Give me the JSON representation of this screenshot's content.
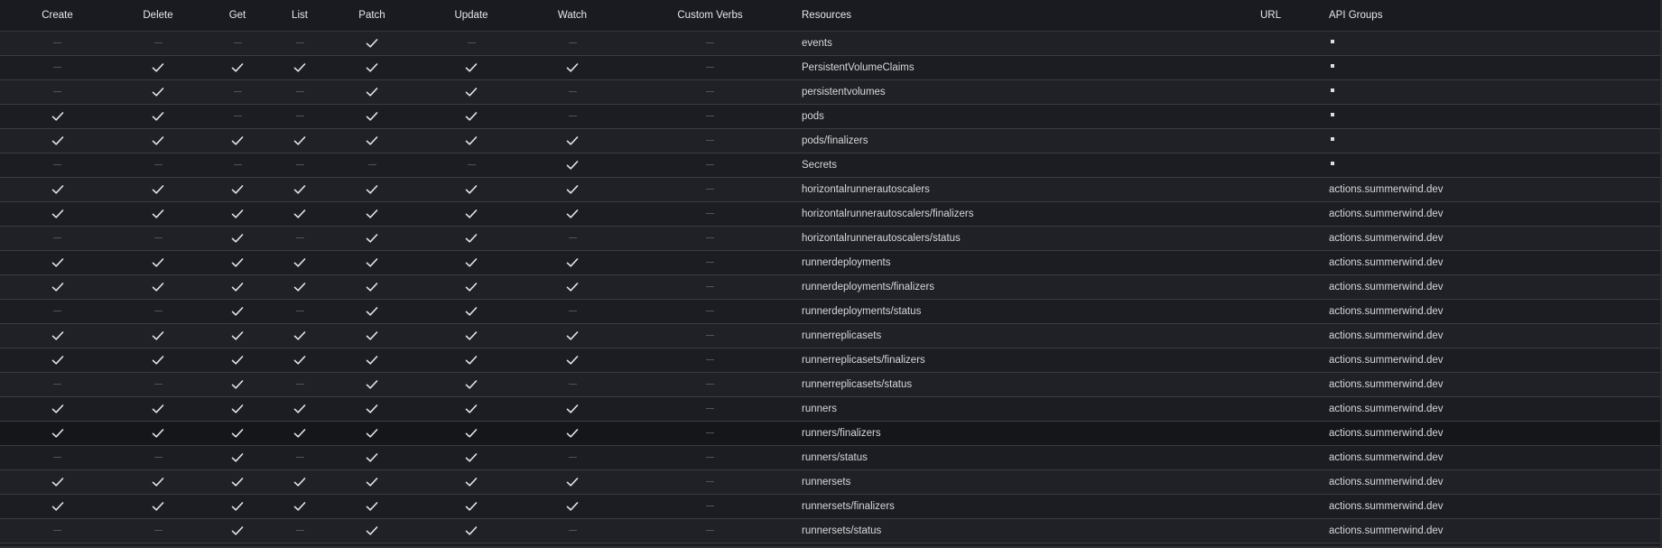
{
  "columns": [
    "Create",
    "Delete",
    "Get",
    "List",
    "Patch",
    "Update",
    "Watch",
    "Custom Verbs",
    "Resources",
    "URL",
    "API Groups"
  ],
  "colors": {
    "background": "#1b1c21",
    "row_alt": "#202126",
    "row_hover": "#15161a",
    "text": "#d8d9dc",
    "dash": "#50535a"
  },
  "icons": {
    "check": "check-icon",
    "empty": "dash-icon",
    "wildcard": "asterisk-icon"
  },
  "rows": [
    {
      "verbs": [
        false,
        false,
        false,
        false,
        true,
        false,
        false
      ],
      "custom": "",
      "resource": "events",
      "url": "",
      "group": "*"
    },
    {
      "verbs": [
        false,
        true,
        true,
        true,
        true,
        true,
        true
      ],
      "custom": "",
      "resource": "PersistentVolumeClaims",
      "url": "",
      "group": "*"
    },
    {
      "verbs": [
        false,
        true,
        false,
        false,
        true,
        true,
        false
      ],
      "custom": "",
      "resource": "persistentvolumes",
      "url": "",
      "group": "*"
    },
    {
      "verbs": [
        true,
        true,
        false,
        false,
        true,
        true,
        false
      ],
      "custom": "",
      "resource": "pods",
      "url": "",
      "group": "*"
    },
    {
      "verbs": [
        true,
        true,
        true,
        true,
        true,
        true,
        true
      ],
      "custom": "",
      "resource": "pods/finalizers",
      "url": "",
      "group": "*"
    },
    {
      "verbs": [
        false,
        false,
        false,
        false,
        false,
        false,
        true
      ],
      "custom": "",
      "resource": "Secrets",
      "url": "",
      "group": "*"
    },
    {
      "verbs": [
        true,
        true,
        true,
        true,
        true,
        true,
        true
      ],
      "custom": "",
      "resource": "horizontalrunnerautoscalers",
      "url": "",
      "group": "actions.summerwind.dev"
    },
    {
      "verbs": [
        true,
        true,
        true,
        true,
        true,
        true,
        true
      ],
      "custom": "",
      "resource": "horizontalrunnerautoscalers/finalizers",
      "url": "",
      "group": "actions.summerwind.dev"
    },
    {
      "verbs": [
        false,
        false,
        true,
        false,
        true,
        true,
        false
      ],
      "custom": "",
      "resource": "horizontalrunnerautoscalers/status",
      "url": "",
      "group": "actions.summerwind.dev"
    },
    {
      "verbs": [
        true,
        true,
        true,
        true,
        true,
        true,
        true
      ],
      "custom": "",
      "resource": "runnerdeployments",
      "url": "",
      "group": "actions.summerwind.dev"
    },
    {
      "verbs": [
        true,
        true,
        true,
        true,
        true,
        true,
        true
      ],
      "custom": "",
      "resource": "runnerdeployments/finalizers",
      "url": "",
      "group": "actions.summerwind.dev"
    },
    {
      "verbs": [
        false,
        false,
        true,
        false,
        true,
        true,
        false
      ],
      "custom": "",
      "resource": "runnerdeployments/status",
      "url": "",
      "group": "actions.summerwind.dev"
    },
    {
      "verbs": [
        true,
        true,
        true,
        true,
        true,
        true,
        true
      ],
      "custom": "",
      "resource": "runnerreplicasets",
      "url": "",
      "group": "actions.summerwind.dev"
    },
    {
      "verbs": [
        true,
        true,
        true,
        true,
        true,
        true,
        true
      ],
      "custom": "",
      "resource": "runnerreplicasets/finalizers",
      "url": "",
      "group": "actions.summerwind.dev"
    },
    {
      "verbs": [
        false,
        false,
        true,
        false,
        true,
        true,
        false
      ],
      "custom": "",
      "resource": "runnerreplicasets/status",
      "url": "",
      "group": "actions.summerwind.dev"
    },
    {
      "verbs": [
        true,
        true,
        true,
        true,
        true,
        true,
        true
      ],
      "custom": "",
      "resource": "runners",
      "url": "",
      "group": "actions.summerwind.dev"
    },
    {
      "verbs": [
        true,
        true,
        true,
        true,
        true,
        true,
        true
      ],
      "custom": "",
      "resource": "runners/finalizers",
      "url": "",
      "group": "actions.summerwind.dev"
    },
    {
      "verbs": [
        false,
        false,
        true,
        false,
        true,
        true,
        false
      ],
      "custom": "",
      "resource": "runners/status",
      "url": "",
      "group": "actions.summerwind.dev"
    },
    {
      "verbs": [
        true,
        true,
        true,
        true,
        true,
        true,
        true
      ],
      "custom": "",
      "resource": "runnersets",
      "url": "",
      "group": "actions.summerwind.dev"
    },
    {
      "verbs": [
        true,
        true,
        true,
        true,
        true,
        true,
        true
      ],
      "custom": "",
      "resource": "runnersets/finalizers",
      "url": "",
      "group": "actions.summerwind.dev"
    },
    {
      "verbs": [
        false,
        false,
        true,
        false,
        true,
        true,
        false
      ],
      "custom": "",
      "resource": "runnersets/status",
      "url": "",
      "group": "actions.summerwind.dev"
    }
  ]
}
